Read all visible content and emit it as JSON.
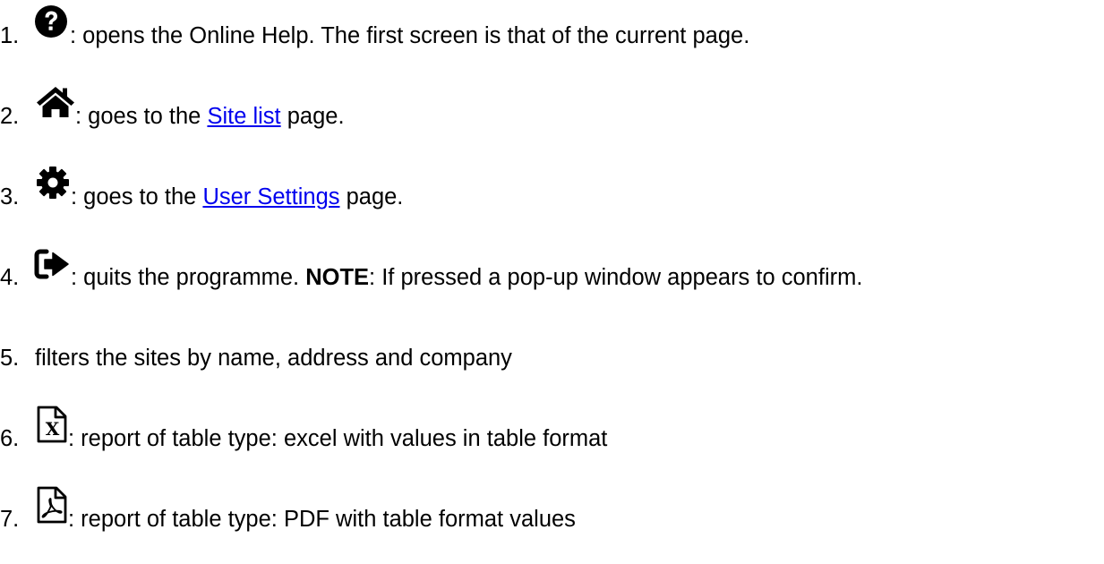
{
  "items": [
    {
      "number": "1.",
      "icon": "question-circle-icon",
      "text": ": opens the Online Help. The first screen is that of the current page."
    },
    {
      "number": "2.",
      "icon": "home-icon",
      "before": ": goes to the ",
      "link": "Site list",
      "after": " page."
    },
    {
      "number": "3.",
      "icon": "gear-icon",
      "before": ": goes to the ",
      "link": "User Settings",
      "after": " page."
    },
    {
      "number": "4.",
      "icon": "sign-out-icon",
      "before": ": quits the programme. ",
      "bold": "NOTE",
      "after": ": If pressed a pop-up window appears to confirm."
    },
    {
      "number": "5.",
      "text": "filters the sites by name, address and company"
    },
    {
      "number": "6.",
      "icon": "excel-file-icon",
      "text": ": report of table type: excel with values in table format"
    },
    {
      "number": "7.",
      "icon": "pdf-file-icon",
      "text": ": report of table type: PDF with table format values"
    }
  ]
}
